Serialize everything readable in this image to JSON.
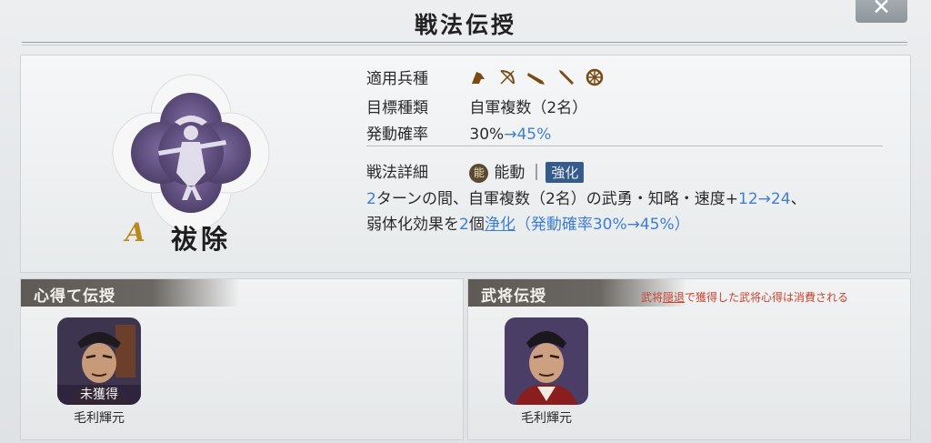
{
  "header": {
    "title": "戦法伝授",
    "close_label": "✕"
  },
  "skill": {
    "grade": "A",
    "name": "祓除",
    "troops_label": "適用兵種",
    "troop_icons": [
      "cavalry-icon",
      "bow-icon",
      "gun-icon",
      "spear-icon",
      "siege-wheel-icon"
    ],
    "target_label": "目標種類",
    "target_value": "自軍複数（2名）",
    "rate_label": "発動確率",
    "rate_base": "30%",
    "rate_upgraded": "→45%",
    "detail_label": "戦法詳細",
    "ability_chip": "能",
    "ability_type": "能動",
    "enhance_tag": "強化",
    "desc_line1": {
      "turns": "2",
      "text_a": "ターンの間、自軍複数（2名）の武勇・知略・速度+",
      "bonus": "12→24",
      "text_b": "、"
    },
    "desc_line2": {
      "text_a": "弱体化効果を",
      "count": "2",
      "text_b": "個",
      "purify": "浄化",
      "rate_note": "（発動確率30%→45%）"
    }
  },
  "learn_section": {
    "title": "心得て伝授",
    "general_name": "毛利輝元",
    "status": "未獲得"
  },
  "general_section": {
    "title": "武将伝授",
    "note_pre": "武将",
    "note_link": "隠退",
    "note_post": "で獲得した武将心得は消費される",
    "general_name": "毛利輝元"
  },
  "colors": {
    "accent_blue": "#3d7fd6",
    "grade_gold": "#b88a1c",
    "warning_red": "#c8452e",
    "emblem_purple": "#5b4a78"
  }
}
